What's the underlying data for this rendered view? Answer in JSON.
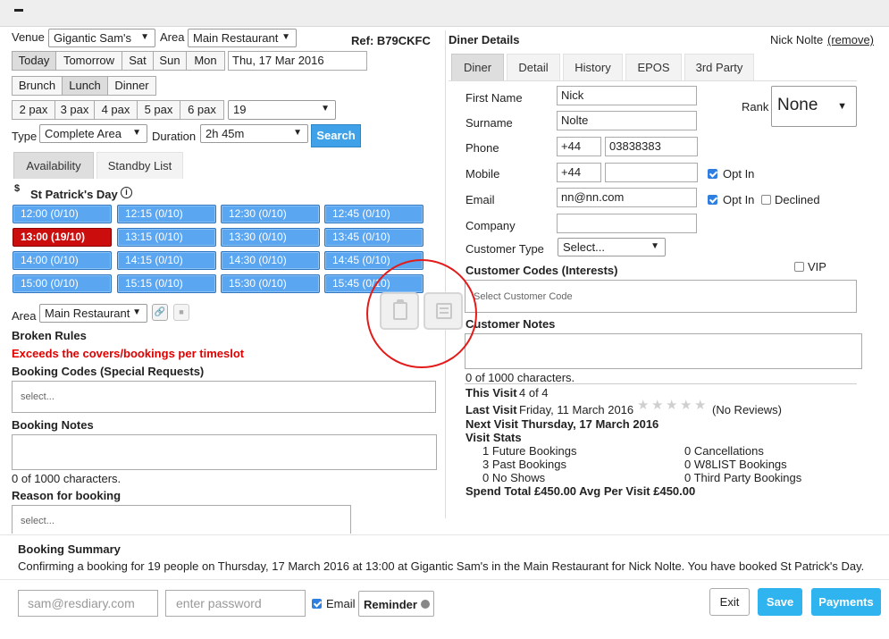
{
  "topbar": {
    "minimize": "−"
  },
  "left": {
    "venue_label": "Venue",
    "venue_value": "Gigantic Sam's",
    "area_label": "Area",
    "area_value": "Main Restaurant",
    "ref": "Ref: B79CKFC",
    "days": [
      "Today",
      "Tomorrow",
      "Sat",
      "Sun",
      "Mon"
    ],
    "date": "Thu, 17 Mar 2016",
    "meals": [
      "Brunch",
      "Lunch",
      "Dinner"
    ],
    "pax": [
      "2 pax",
      "3 pax",
      "4 pax",
      "5 pax",
      "6 pax"
    ],
    "pax_value": "19",
    "type_label": "Type",
    "type_value": "Complete Area",
    "duration_label": "Duration",
    "duration_value": "2h 45m",
    "search": "Search",
    "tabs": [
      "Availability",
      "Standby List"
    ],
    "dollar": "$",
    "event_title": "St Patrick's Day",
    "info_icon": "i",
    "slots": [
      [
        "12:00 (0/10)",
        "12:15 (0/10)",
        "12:30 (0/10)",
        "12:45 (0/10)"
      ],
      [
        "13:00 (19/10)",
        "13:15 (0/10)",
        "13:30 (0/10)",
        "13:45 (0/10)"
      ],
      [
        "14:00 (0/10)",
        "14:15 (0/10)",
        "14:30 (0/10)",
        "14:45 (0/10)"
      ],
      [
        "15:00 (0/10)",
        "15:15 (0/10)",
        "15:30 (0/10)",
        "15:45 (0/10)"
      ]
    ],
    "area2_label": "Area",
    "area2_value": "Main Restaurant",
    "broken_rules": "Broken Rules",
    "rule_error": "Exceeds the covers/bookings per timeslot",
    "booking_codes": "Booking Codes (Special Requests)",
    "booking_codes_ph": "select...",
    "booking_notes": "Booking Notes",
    "notes_count": "0 of 1000 characters.",
    "reason": "Reason for booking",
    "reason_ph": "select..."
  },
  "right": {
    "title": "Diner Details",
    "diner_name": "Nick Nolte",
    "remove": "(remove)",
    "tabs": [
      "Diner",
      "Detail",
      "History",
      "EPOS",
      "3rd Party"
    ],
    "first_name_label": "First Name",
    "first_name": "Nick",
    "surname_label": "Surname",
    "surname": "Nolte",
    "rank_label": "Rank",
    "rank_value": "None",
    "phone_label": "Phone",
    "phone_cc": "+44",
    "phone": "03838383",
    "mobile_label": "Mobile",
    "mobile_cc": "+44",
    "mobile": "",
    "optin": "Opt In",
    "email_label": "Email",
    "email": "nn@nn.com",
    "declined": "Declined",
    "company_label": "Company",
    "company": "",
    "ctype_label": "Customer Type",
    "ctype_value": "Select...",
    "codes_label": "Customer Codes (Interests)",
    "vip": "VIP",
    "codes_ph": "Select Customer Code",
    "notes_label": "Customer Notes",
    "notes_count": "0 of 1000 characters.",
    "this_visit_label": "This Visit",
    "this_visit": "4 of 4",
    "last_visit_label": "Last Visit",
    "last_visit": "Friday, 11 March 2016",
    "reviews": "(No Reviews)",
    "next_visit": "Next Visit Thursday, 17 March 2016",
    "stats_label": "Visit Stats",
    "stats_left": [
      "1 Future Bookings",
      "3 Past Bookings",
      "0 No Shows"
    ],
    "stats_right": [
      "0 Cancellations",
      "0 W8LIST Bookings",
      "0 Third Party Bookings"
    ],
    "spend": "Spend Total £450.00 Avg Per Visit £450.00"
  },
  "summary": {
    "title": "Booking Summary",
    "text": "Confirming a booking for 19 people on Thursday, 17 March 2016 at 13:00 at Gigantic Sam's in the Main Restaurant for Nick Nolte. You have booked St Patrick's Day."
  },
  "footer": {
    "email_ph": "sam@resdiary.com",
    "password_ph": "enter password",
    "email_label": "Email",
    "reminder": "Reminder",
    "exit": "Exit",
    "save": "Save",
    "payments": "Payments"
  },
  "colors": {
    "accent": "#3fa2e8",
    "slot": "#5aa6f0",
    "slot_full": "#cc0d0d",
    "error": "#e00000",
    "highlight_circle": "#e21b1b"
  }
}
